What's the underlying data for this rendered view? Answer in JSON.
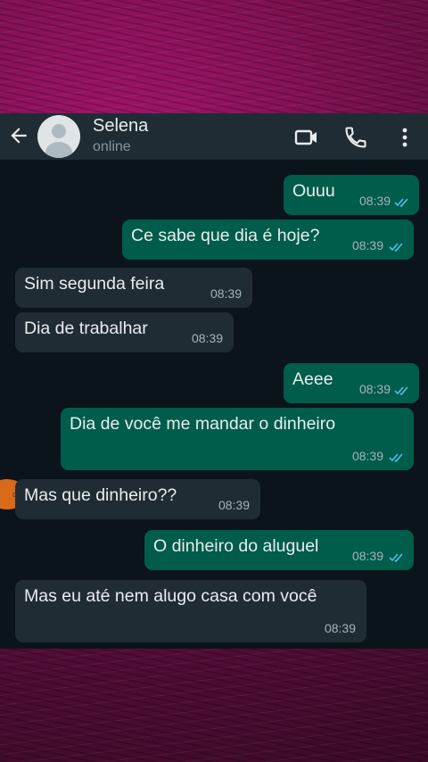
{
  "contact": {
    "name": "Selena",
    "status": "online"
  },
  "icons": {
    "back": "arrow-left-icon",
    "video": "video-call-icon",
    "call": "phone-call-icon",
    "menu": "more-vertical-icon"
  },
  "colors": {
    "header": "#1f2c33",
    "chat_bg": "#0b141a",
    "outgoing": "#005c4b",
    "incoming": "#202c33",
    "read_ticks": "#53bdeb",
    "frame": "#a4146b"
  },
  "messages": [
    {
      "dir": "out",
      "text": "Ouuu",
      "time": "08:39",
      "read": true
    },
    {
      "dir": "out",
      "text": "Ce sabe que dia é hoje?",
      "time": "08:39",
      "read": true
    },
    {
      "dir": "in",
      "text": "Sim segunda feira",
      "time": "08:39"
    },
    {
      "dir": "in",
      "text": "Dia de trabalhar",
      "time": "08:39"
    },
    {
      "dir": "out",
      "text": "Aeee",
      "time": "08:39",
      "read": true
    },
    {
      "dir": "out",
      "text": "Dia de você me mandar o dinheiro",
      "time": "08:39",
      "read": true
    },
    {
      "dir": "in",
      "text": "Mas que dinheiro??",
      "time": "08:39"
    },
    {
      "dir": "out",
      "text": "O dinheiro do aluguel",
      "time": "08:39",
      "read": true
    },
    {
      "dir": "in",
      "text": "Mas eu até nem alugo casa com você",
      "time": "08:39"
    }
  ]
}
